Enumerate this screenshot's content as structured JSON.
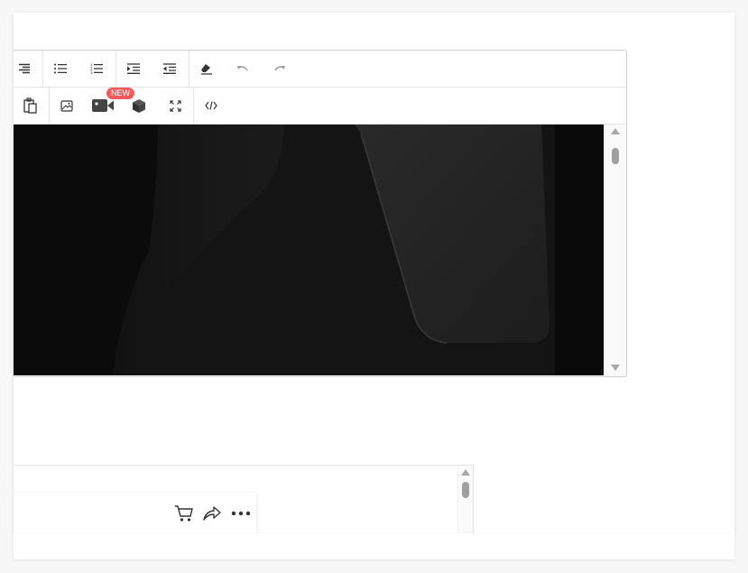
{
  "toolbar": {
    "row1": [
      {
        "name": "align-right-button",
        "icon": "align-right-icon"
      },
      {
        "name": "bullet-list-button",
        "icon": "bullet-list-icon"
      },
      {
        "name": "numbered-list-button",
        "icon": "numbered-list-icon"
      },
      {
        "name": "indent-button",
        "icon": "indent-icon"
      },
      {
        "name": "outdent-button",
        "icon": "outdent-icon"
      },
      {
        "name": "clear-format-button",
        "icon": "eraser-icon"
      },
      {
        "name": "undo-button",
        "icon": "undo-icon",
        "disabled": true
      },
      {
        "name": "redo-button",
        "icon": "redo-icon",
        "disabled": true
      }
    ],
    "row2": [
      {
        "name": "paste-button",
        "icon": "clipboard-icon"
      },
      {
        "name": "insert-image-button",
        "icon": "image-icon"
      },
      {
        "name": "insert-video-button",
        "icon": "video-camera-icon"
      },
      {
        "name": "insert-3d-button",
        "icon": "cube-icon"
      },
      {
        "name": "fullscreen-button",
        "icon": "fullscreen-icon"
      },
      {
        "name": "source-code-button",
        "icon": "code-icon"
      }
    ],
    "new_badge": "NEW"
  },
  "editor": {
    "image": "dark-product-photo"
  },
  "actions": [
    {
      "name": "cart-button",
      "icon": "cart-icon"
    },
    {
      "name": "share-button",
      "icon": "share-icon"
    },
    {
      "name": "more-button",
      "icon": "more-horizontal-icon"
    }
  ],
  "colors": {
    "badge": "#f05b5b",
    "border": "#cfcfcf",
    "icon": "#333333",
    "icon_disabled": "#9a9a9a"
  }
}
